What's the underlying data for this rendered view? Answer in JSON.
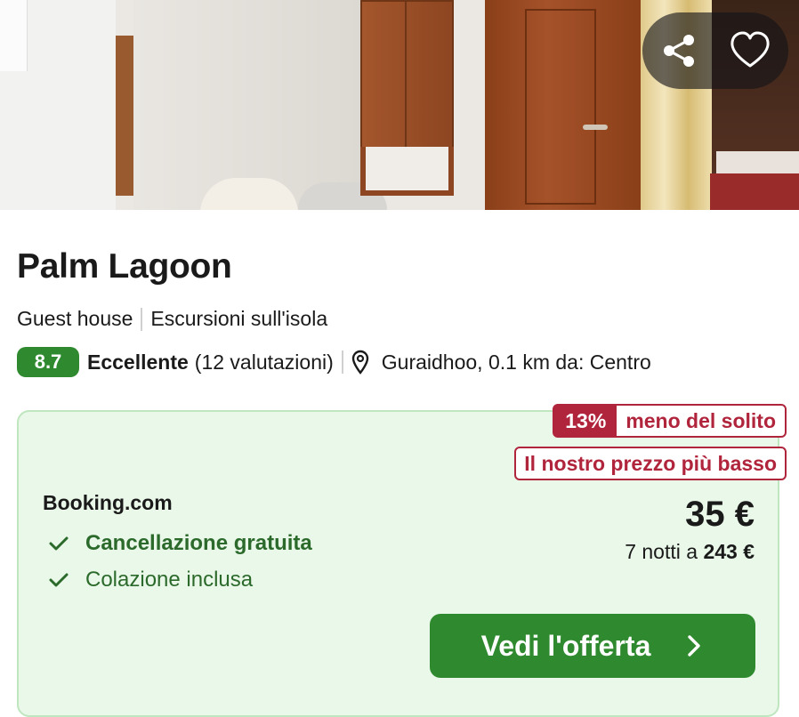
{
  "photo": {
    "alt_description": ""
  },
  "actions": {
    "share_icon": "share-icon",
    "favorite_icon": "heart-icon"
  },
  "hotel": {
    "name": "Palm Lagoon",
    "type": "Guest house",
    "feature": "Escursioni sull'isola",
    "score": "8.7",
    "rating_word": "Eccellente",
    "reviews": "(12 valutazioni)",
    "location": "Guraidhoo, 0.1 km da: Centro"
  },
  "offer": {
    "discount_pct": "13%",
    "discount_text": "meno del solito",
    "lowest_badge": "Il nostro prezzo più basso",
    "provider": "Booking.com",
    "perks": [
      "Cancellazione gratuita",
      "Colazione inclusa"
    ],
    "price": "35 €",
    "total_prefix": "7 notti a",
    "total_price": "243 €",
    "cta_label": "Vedi l'offerta"
  },
  "colors": {
    "score_bg": "#2f8a2f",
    "offer_bg": "#eaf8ea",
    "badge_red": "#b0243c",
    "perk_green": "#2b6a2b",
    "cta_bg": "#2f8a2f"
  }
}
